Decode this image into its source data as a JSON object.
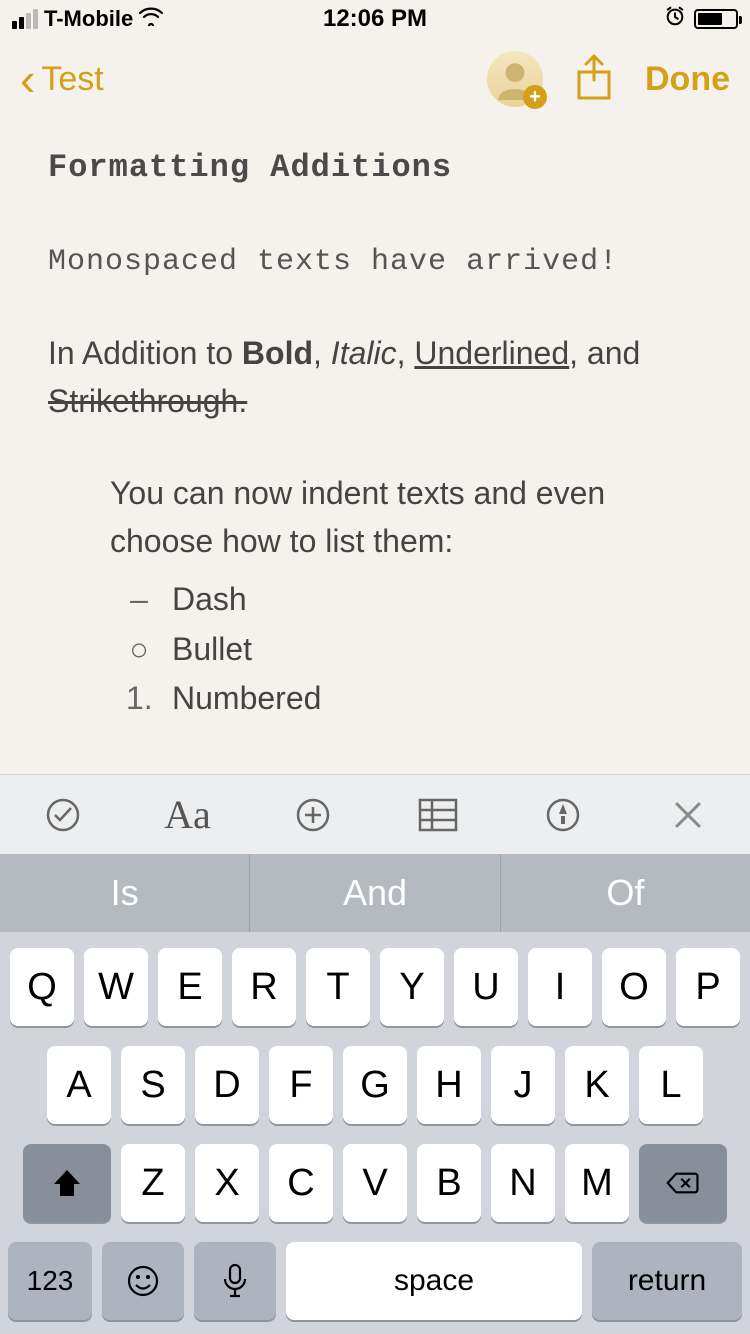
{
  "status": {
    "carrier": "T-Mobile",
    "time": "12:06 PM"
  },
  "nav": {
    "back_label": "Test",
    "done_label": "Done"
  },
  "note": {
    "title": "Formatting Additions",
    "mono_line": "Monospaced texts have arrived!",
    "rich_prefix": "In Addition to ",
    "bold_word": "Bold",
    "sep1": ", ",
    "italic_word": "Italic",
    "sep2": ", ",
    "underlined_word": "Underlined",
    "sep3": ", and ",
    "strike_word": "Strikethrough.",
    "indent_text": "You can now indent texts and even choose how to list them:",
    "list": {
      "dash_marker": "–",
      "dash_label": "Dash",
      "bullet_marker": "○",
      "bullet_label": "Bullet",
      "num_marker": "1.",
      "num_label": "Numbered"
    }
  },
  "format_bar": {
    "aa": "Aa"
  },
  "suggestions": [
    "Is",
    "And",
    "Of"
  ],
  "keyboard": {
    "row1": [
      "Q",
      "W",
      "E",
      "R",
      "T",
      "Y",
      "U",
      "I",
      "O",
      "P"
    ],
    "row2": [
      "A",
      "S",
      "D",
      "F",
      "G",
      "H",
      "J",
      "K",
      "L"
    ],
    "row3": [
      "Z",
      "X",
      "C",
      "V",
      "B",
      "N",
      "M"
    ],
    "num_key": "123",
    "space": "space",
    "return": "return"
  }
}
